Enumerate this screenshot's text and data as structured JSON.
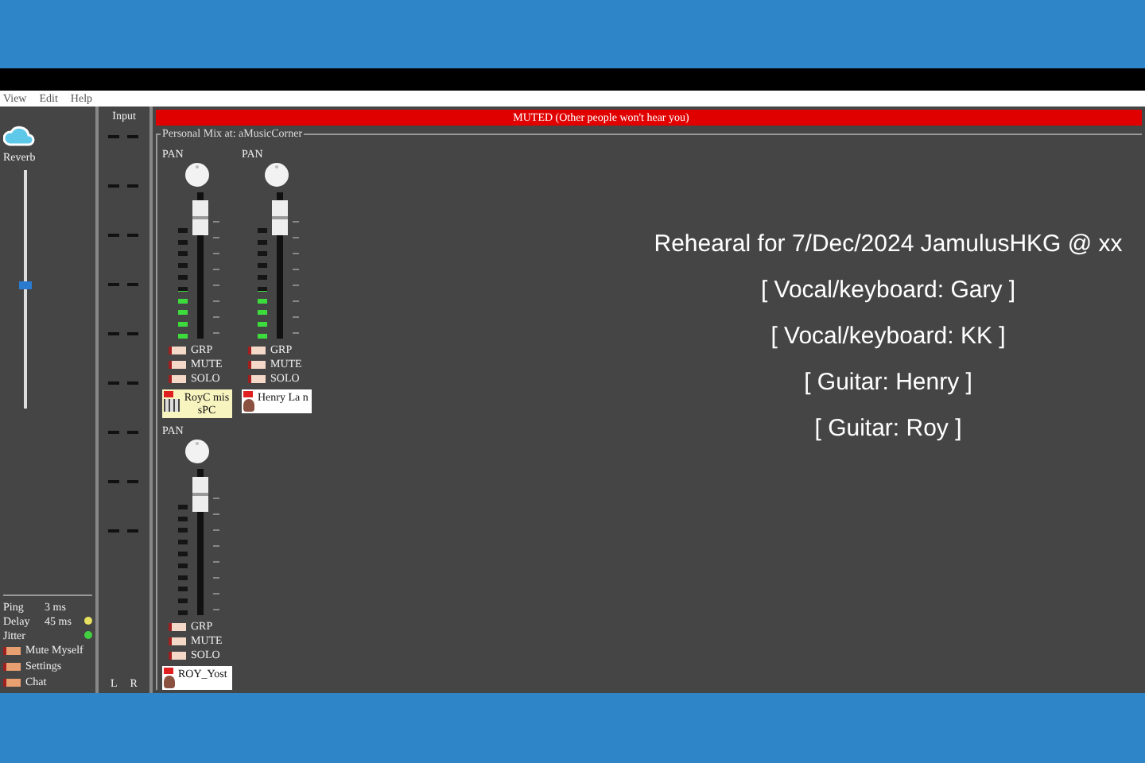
{
  "menu": [
    "View",
    "Edit",
    "Help"
  ],
  "left_panel": {
    "reverb_label": "Reverb",
    "reverb": {
      "level": 0.5
    },
    "stats": [
      {
        "label": "Ping",
        "value": "3 ms"
      },
      {
        "label": "Delay",
        "value": "45 ms",
        "color": "#e8e060"
      },
      {
        "label": "Jitter",
        "color": "#40d040"
      }
    ],
    "buttons": [
      "Mute Myself",
      "Settings",
      "Chat"
    ]
  },
  "input_meter": {
    "title": "Input",
    "left": "L",
    "right": "R"
  },
  "muted_banner": "MUTED (Other people won't hear you)",
  "mix_title": "Personal Mix at: aMusicCorner",
  "channels": [
    {
      "pan_label": "PAN",
      "fader": {
        "level": 0.9
      },
      "meter": {
        "level": 0.4
      },
      "buttons": [
        "GRP",
        "MUTE",
        "SOLO"
      ],
      "name": "RoyC mis sPC",
      "kind": "instrument"
    },
    {
      "pan_label": "PAN",
      "fader": {
        "level": 0.9
      },
      "meter": {
        "level": 0.4
      },
      "buttons": [
        "GRP",
        "MUTE",
        "SOLO"
      ],
      "name": "Henry La n",
      "kind": "person"
    },
    {
      "pan_label": "PAN",
      "fader": {
        "level": 0.9
      },
      "meter": {
        "level": 0
      },
      "buttons": [
        "GRP",
        "MUTE",
        "SOLO"
      ],
      "name": "ROY_Yost",
      "kind": "person"
    }
  ],
  "notes": [
    "Rehearal for 7/Dec/2024 JamulusHKG @ xx",
    "[ Vocal/keyboard: Gary ]",
    "[ Vocal/keyboard: KK ]",
    "[ Guitar:  Henry ]",
    "[ Guitar:  Roy ]"
  ]
}
